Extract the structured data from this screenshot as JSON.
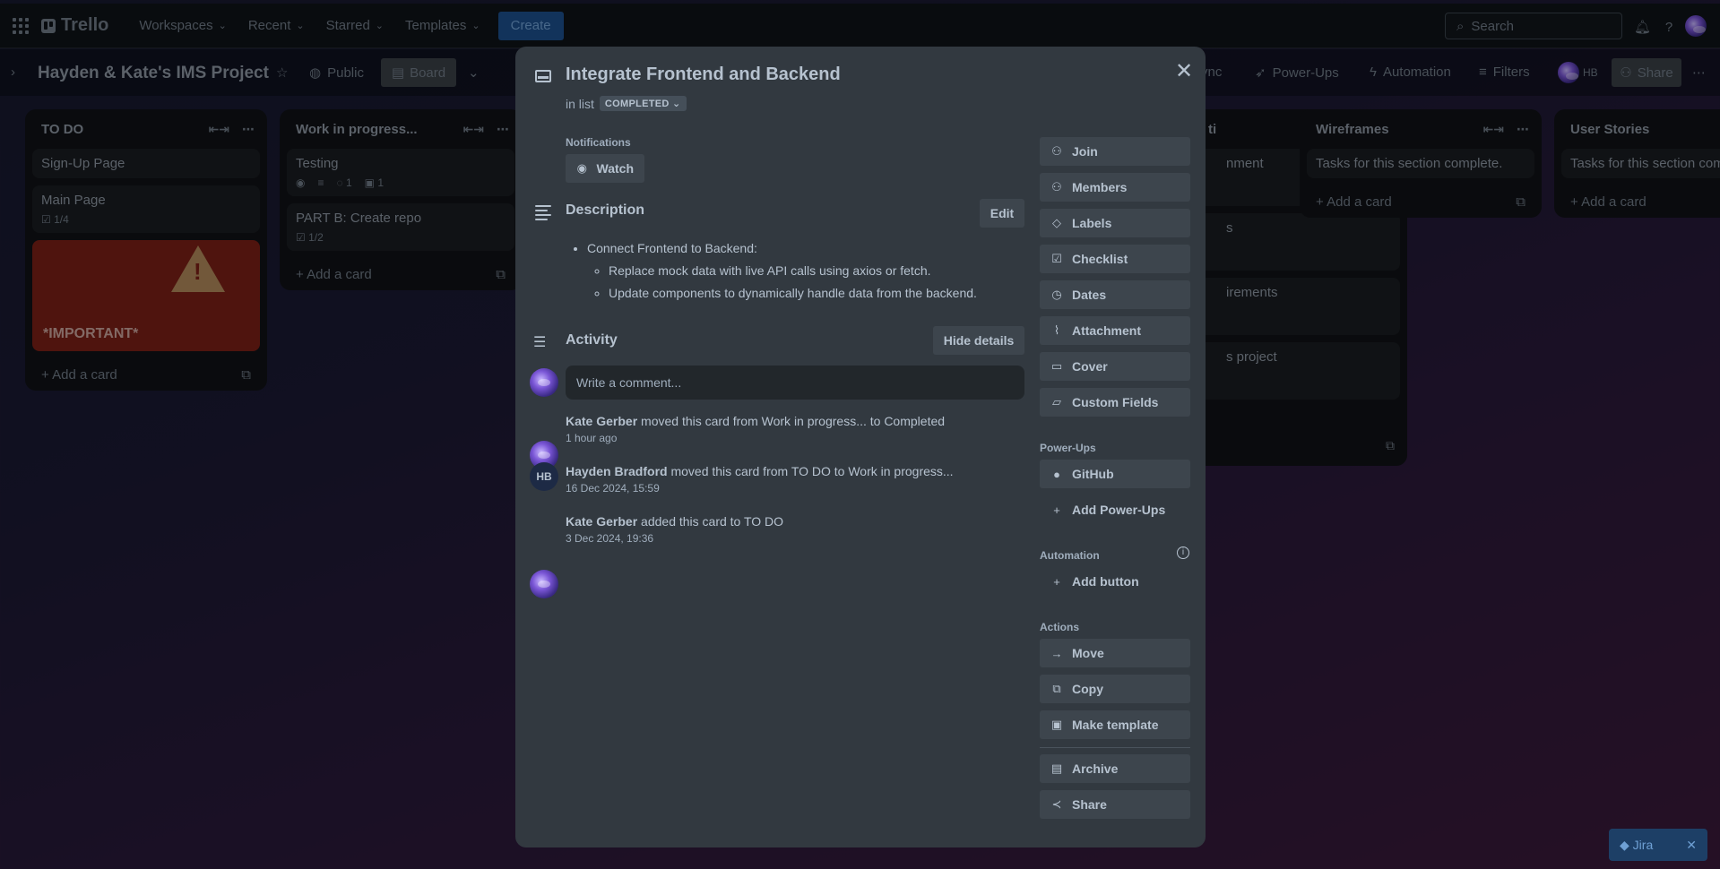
{
  "topbar": {
    "logo": "Trello",
    "nav": [
      "Workspaces",
      "Recent",
      "Starred",
      "Templates"
    ],
    "create": "Create",
    "search_placeholder": "Search"
  },
  "boardbar": {
    "title": "Hayden & Kate's IMS Project",
    "visibility": "Public",
    "view": "Board",
    "right_items": [
      "ync",
      "Power-Ups",
      "Automation",
      "Filters"
    ],
    "member_initials": "HB",
    "share": "Share"
  },
  "lists": [
    {
      "title": "TO DO",
      "cards": [
        {
          "title": "Sign-Up Page"
        },
        {
          "title": "Main Page",
          "checklist": "1/4"
        }
      ],
      "important_card": "*IMPORTANT*",
      "add_card": "Add a card"
    },
    {
      "title": "Work in progress...",
      "cards": [
        {
          "title": "Testing",
          "comments": "1",
          "attachments": "1"
        },
        {
          "title": "PART B: Create repo",
          "checklist": "1/2"
        }
      ],
      "add_card": "Add a card"
    },
    {
      "title": "Wireframes",
      "cards": [
        {
          "title": "Tasks for this section complete."
        }
      ],
      "add_card": "Add a card"
    },
    {
      "title": "User Stories",
      "cards": [
        {
          "title": "Tasks for this section com"
        }
      ],
      "add_card": "Add a card"
    }
  ],
  "hidden_column": {
    "title_tail": "ti",
    "card_tails": [
      "nment",
      "s",
      "irements",
      "s project"
    ]
  },
  "modal": {
    "title": "Integrate Frontend and Backend",
    "in_list_prefix": "in list",
    "list_badge": "COMPLETED",
    "notifications_label": "Notifications",
    "watch": "Watch",
    "description_heading": "Description",
    "edit": "Edit",
    "description": {
      "item": "Connect Frontend to Backend:",
      "subitems": [
        "Replace mock data with live API calls using axios or fetch.",
        "Update components to dynamically handle data from the backend."
      ]
    },
    "activity_heading": "Activity",
    "hide_details": "Hide details",
    "comment_placeholder": "Write a comment...",
    "activity": [
      {
        "user": "Kate Gerber",
        "text": "moved this card from Work in progress... to Completed",
        "time": "1 hour ago",
        "avatar": "image"
      },
      {
        "user": "Hayden Bradford",
        "text": "moved this card from TO DO to Work in progress...",
        "time": "16 Dec 2024, 15:59",
        "avatar": "HB"
      },
      {
        "user": "Kate Gerber",
        "text": "added this card to TO DO",
        "time": "3 Dec 2024, 19:36",
        "avatar": "image"
      }
    ],
    "sidebar": {
      "buttons": [
        "Join",
        "Members",
        "Labels",
        "Checklist",
        "Dates",
        "Attachment",
        "Cover",
        "Custom Fields"
      ],
      "powerups_label": "Power-Ups",
      "github": "GitHub",
      "add_powerups": "Add Power-Ups",
      "automation_label": "Automation",
      "add_button": "Add button",
      "actions_label": "Actions",
      "actions": [
        "Move",
        "Copy",
        "Make template"
      ],
      "archive": "Archive",
      "share": "Share"
    }
  },
  "jira": {
    "label": "Jira"
  }
}
